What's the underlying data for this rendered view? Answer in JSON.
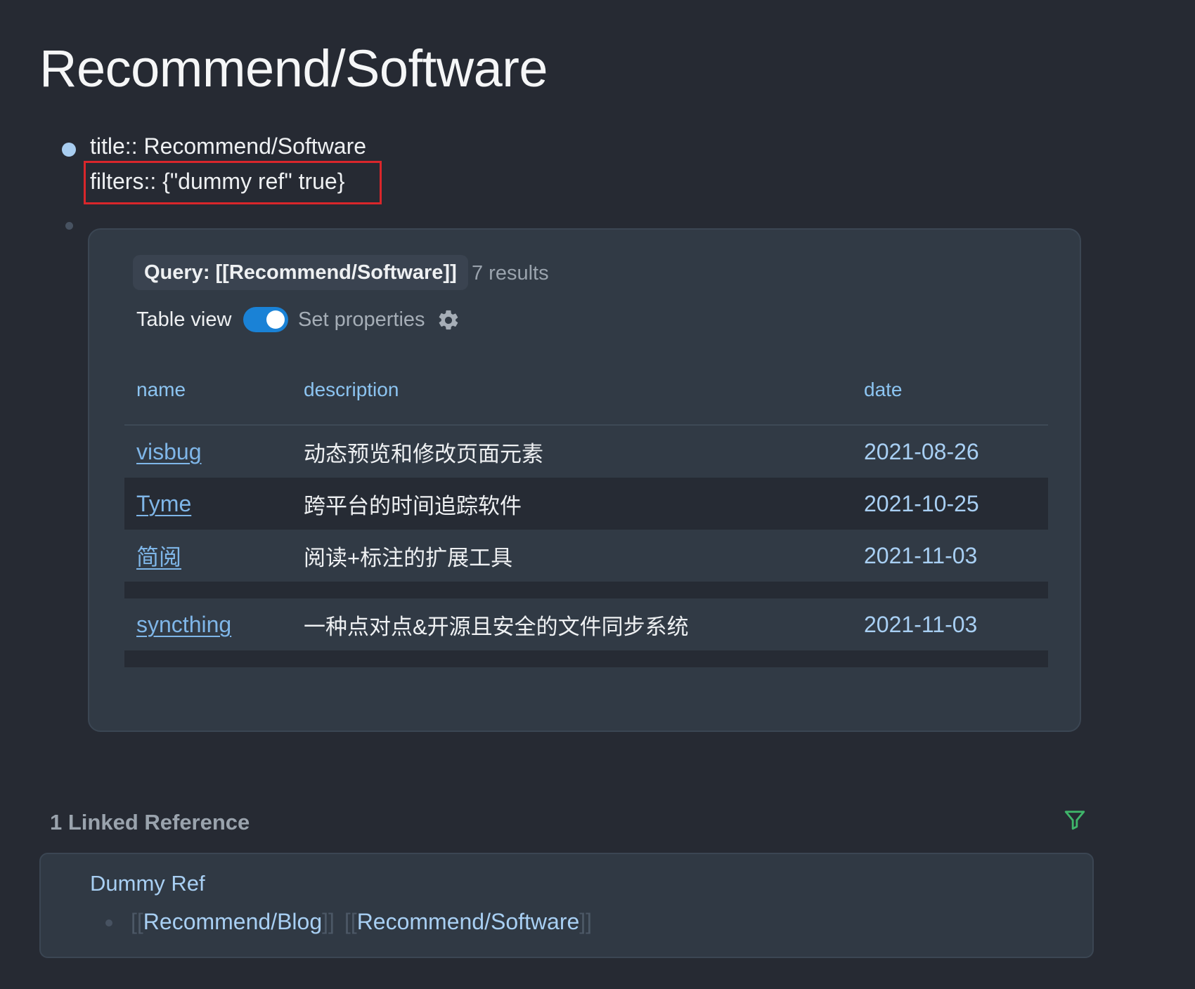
{
  "page": {
    "title": "Recommend/Software"
  },
  "properties": {
    "title_line": "title:: Recommend/Software",
    "filters_line": "filters:: {\"dummy ref\" true}"
  },
  "query": {
    "label": "Query: [[Recommend/Software]]",
    "results": "7 results",
    "table_view_label": "Table view",
    "table_view_on": true,
    "set_properties_label": "Set properties",
    "columns": [
      "name",
      "description",
      "date"
    ],
    "rows": [
      {
        "name": "visbug",
        "description": "动态预览和修改页面元素",
        "date": "2021-08-26"
      },
      {
        "name": "Tyme",
        "description": "跨平台的时间追踪软件",
        "date": "2021-10-25"
      },
      {
        "name": "简阅",
        "description": "阅读+标注的扩展工具",
        "date": "2021-11-03"
      },
      {
        "name": "",
        "description": "",
        "date": ""
      },
      {
        "name": "syncthing",
        "description": "一种点对点&开源且安全的文件同步系统",
        "date": "2021-11-03"
      },
      {
        "name": "",
        "description": "",
        "date": ""
      }
    ]
  },
  "linked_references": {
    "heading": "1 Linked Reference",
    "filter_icon": "filter-icon",
    "filter_icon_color": "#3fb56a",
    "items": [
      {
        "page": "Dummy Ref",
        "refs": [
          "Recommend/Blog",
          "Recommend/Software"
        ],
        "bracket_open": "[[",
        "bracket_close": "]]"
      }
    ]
  },
  "colors": {
    "background": "#262a33",
    "card": "#313a45",
    "accent_blue": "#1a82d6",
    "link": "#7fb6e8",
    "highlight_border": "#d9262b"
  }
}
